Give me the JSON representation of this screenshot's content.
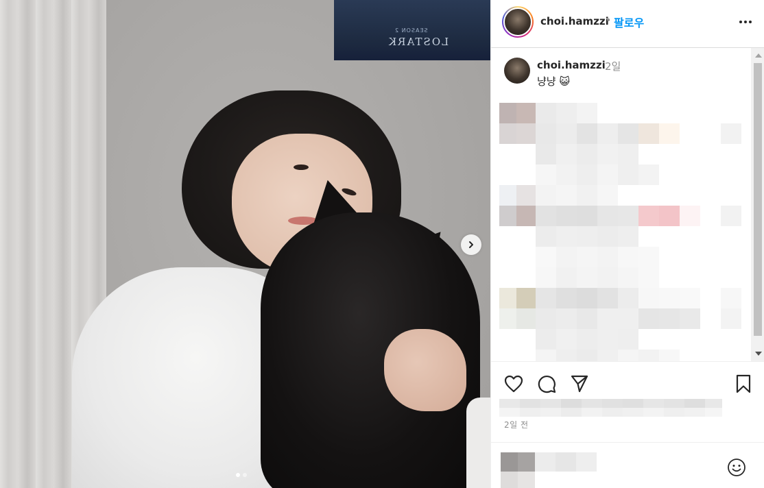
{
  "post": {
    "username": "choi.hamzzi",
    "separator": "•",
    "follow_label": "팔로우",
    "more_icon": "more-horizontal-icon"
  },
  "caption": {
    "username": "choi.hamzzi",
    "time": "2일",
    "text": "냥냥 😺"
  },
  "photo": {
    "poster_title": "LOSTARK",
    "poster_subtitle": "SEASON 2",
    "carousel_total": 2,
    "carousel_current": 1
  },
  "actions": {
    "like_icon": "heart-icon",
    "comment_icon": "comment-icon",
    "share_icon": "send-icon",
    "save_icon": "bookmark-icon",
    "timestamp": "2일 전"
  },
  "composer": {
    "emoji_icon": "smile-emoji-icon"
  },
  "colors": {
    "accent": "#0095f6",
    "text": "#262626",
    "muted": "#8e8e8e",
    "border": "#dbdbdb"
  }
}
